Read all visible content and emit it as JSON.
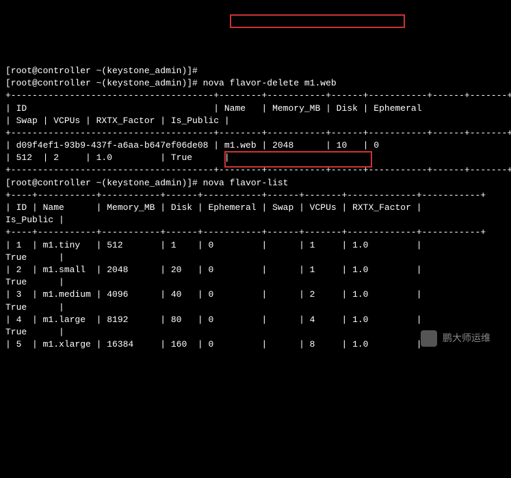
{
  "prompts": {
    "line1": "[root@controller ~(keystone_admin)]#",
    "line2_prefix": "[root@controller ~(keystone_admin)]# ",
    "line2_cmd": "nova flavor-delete m1.web",
    "line3_prefix": "[root@controller ~(keystone_admin)]# ",
    "line3_cmd": "nova flavor-list"
  },
  "table1": {
    "sep_top": "+--------------------------------------+--------+-----------+------+-----------+------+-------+-------------+-----------+",
    "header1": "| ID                                   | Name   | Memory_MB | Disk | Ephemeral",
    "header2": "| Swap | VCPUs | RXTX_Factor | Is_Public |",
    "sep_mid": "+--------------------------------------+--------+-----------+------+-----------+------+-------+-------------+-----------+",
    "row1": "| d09f4ef1-93b9-437f-a6aa-b647ef06de08 | m1.web | 2048      | 10   | 0        ",
    "row2": "| 512  | 2     | 1.0         | True      |",
    "sep_bot": "+--------------------------------------+--------+-----------+------+-----------+------+-------+-------------+-----------+"
  },
  "table2": {
    "sep_top": "+----+-----------+-----------+------+-----------+------+-------+-------------+-----------+",
    "header1": "| ID | Name      | Memory_MB | Disk | Ephemeral | Swap | VCPUs | RXTX_Factor | ",
    "header2": "Is_Public |",
    "sep_mid": "+----+-----------+-----------+------+-----------+------+-------+-------------+-----------+",
    "r1a": "| 1  | m1.tiny   | 512       | 1    | 0         |      | 1     | 1.0         | ",
    "r1b": "True      |",
    "r2a": "| 2  | m1.small  | 2048      | 20   | 0         |      | 1     | 1.0         | ",
    "r2b": "True      |",
    "r3a": "| 3  | m1.medium | 4096      | 40   | 0         |      | 2     | 1.0         | ",
    "r3b": "True      |",
    "r4a": "| 4  | m1.large  | 8192      | 80   | 0         |      | 4     | 1.0         | ",
    "r4b": "True      |",
    "r5a": "| 5  | m1.xlarge | 16384     | 160  | 0         |      | 8     | 1.0         | "
  },
  "watermark": {
    "text": "鹏大师运维"
  }
}
